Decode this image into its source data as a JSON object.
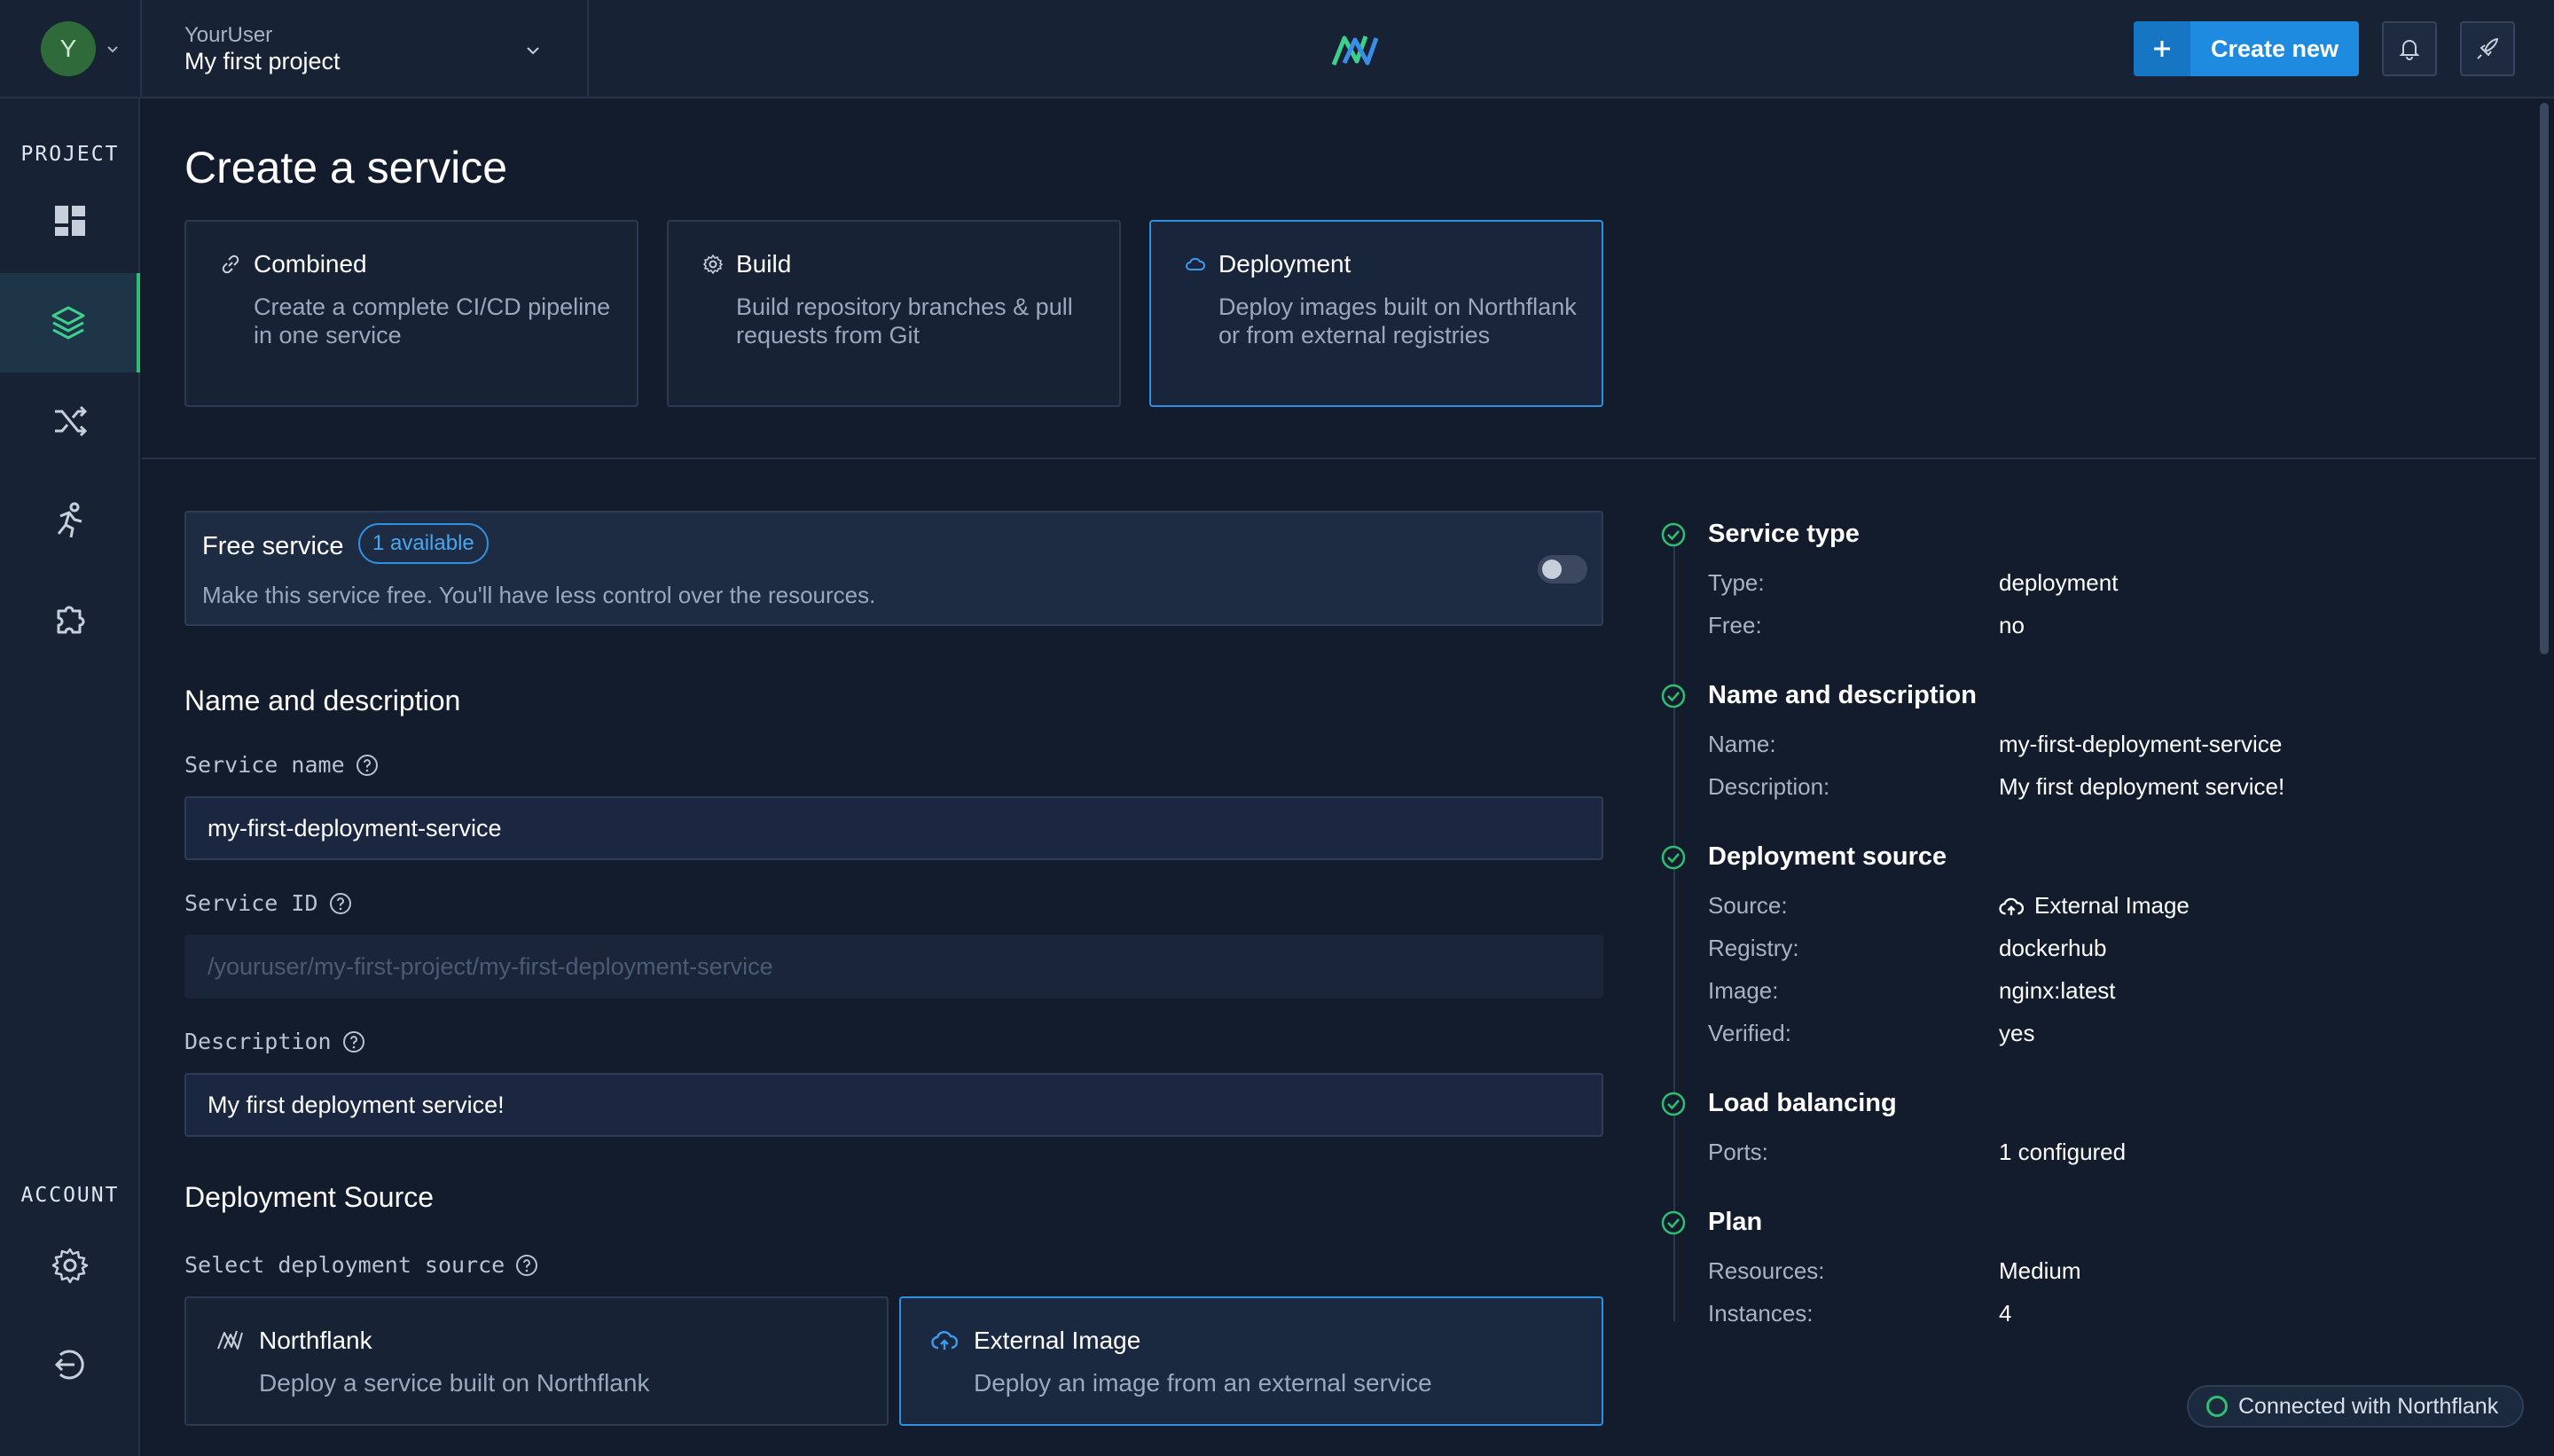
{
  "header": {
    "avatar_initial": "Y",
    "user": "YourUser",
    "project": "My first project",
    "create_new_label": "Create new",
    "accent_color": "#1e8ae0"
  },
  "sidebar": {
    "project_heading": "PROJECT",
    "account_heading": "ACCOUNT",
    "items": [
      {
        "icon": "dashboard-icon"
      },
      {
        "icon": "layers-icon",
        "active": true
      },
      {
        "icon": "shuffle-icon"
      },
      {
        "icon": "runner-icon"
      },
      {
        "icon": "puzzle-icon"
      }
    ],
    "account_items": [
      {
        "icon": "gear-icon"
      },
      {
        "icon": "logout-icon"
      }
    ]
  },
  "page": {
    "title": "Create a service",
    "service_types": [
      {
        "title": "Combined",
        "desc": "Create a complete CI/CD pipeline in one service",
        "icon": "link-icon"
      },
      {
        "title": "Build",
        "desc": "Build repository branches & pull requests from Git",
        "icon": "gear-icon"
      },
      {
        "title": "Deployment",
        "desc": "Deploy images built on Northflank or from external registries",
        "icon": "cloud-icon",
        "selected": true
      }
    ]
  },
  "form": {
    "free_service": {
      "title": "Free service",
      "badge": "1 available",
      "desc": "Make this service free. You'll have less control over the resources."
    },
    "name_section_title": "Name and description",
    "service_name_label": "Service name",
    "service_name_value": "my-first-deployment-service",
    "service_id_label": "Service ID",
    "service_id_value": "/youruser/my-first-project/my-first-deployment-service",
    "description_label": "Description",
    "description_value": "My first deployment service!",
    "source_section_title": "Deployment Source",
    "select_source_label": "Select deployment source",
    "sources": [
      {
        "title": "Northflank",
        "desc": "Deploy a service built on Northflank",
        "icon": "northflank-icon"
      },
      {
        "title": "External Image",
        "desc": "Deploy an image from an external service",
        "icon": "cloud-upload-icon",
        "selected": true
      }
    ]
  },
  "summary": {
    "sections": [
      {
        "title": "Service type",
        "rows": [
          {
            "k": "Type:",
            "v": "deployment"
          },
          {
            "k": "Free:",
            "v": "no"
          }
        ]
      },
      {
        "title": "Name and description",
        "rows": [
          {
            "k": "Name:",
            "v": "my-first-deployment-service"
          },
          {
            "k": "Description:",
            "v": "My first deployment service!"
          }
        ]
      },
      {
        "title": "Deployment source",
        "rows": [
          {
            "k": "Source:",
            "v": "External Image"
          },
          {
            "k": "Registry:",
            "v": "dockerhub"
          },
          {
            "k": "Image:",
            "v": "nginx:latest"
          },
          {
            "k": "Verified:",
            "v": "yes"
          }
        ]
      },
      {
        "title": "Load balancing",
        "rows": [
          {
            "k": "Ports:",
            "v": "1 configured"
          }
        ]
      },
      {
        "title": "Plan",
        "rows": [
          {
            "k": "Resources:",
            "v": "Medium"
          },
          {
            "k": "Instances:",
            "v": "4"
          }
        ]
      }
    ],
    "status_color": "#2fbf71"
  },
  "status": {
    "connected": "Connected with Northflank"
  }
}
